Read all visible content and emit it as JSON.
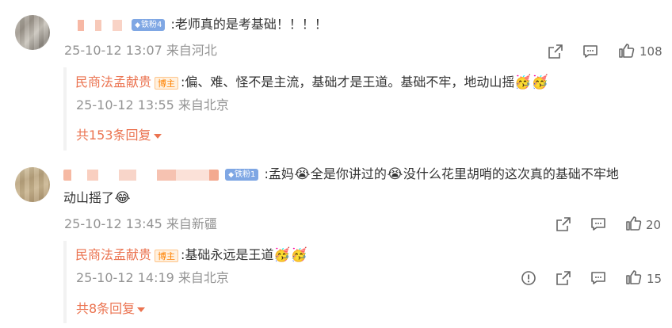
{
  "comments": [
    {
      "user_name_hidden": "",
      "fan_badge": "铁粉4",
      "text": ":老师真的是考基础！！！！",
      "meta": "25-10-12 13:07  来自河北",
      "likes": "108",
      "reply": {
        "author": "民商法孟献贵",
        "host_badge": "博主",
        "text": ":偏、难、怪不是主流，基础才是王道。基础不牢，地动山摇",
        "emoji": "🥳🥳",
        "meta": "25-10-12 13:55  来自北京"
      },
      "more_replies": "共153条回复"
    },
    {
      "user_name_hidden": "",
      "fan_badge": "铁粉1",
      "text_part1": ":孟妈",
      "text_part2": "全是你讲过的",
      "text_part3": "没什么花里胡哨的这次真的基础不牢地",
      "text_line2": "动山摇了",
      "emoji_cry": "😭",
      "emoji_laugh": "😂",
      "meta": "25-10-12 13:45  来自新疆",
      "likes": "20",
      "reply": {
        "author": "民商法孟献贵",
        "host_badge": "博主",
        "text": ":基础永远是王道",
        "emoji": "🥳🥳",
        "meta": "25-10-12 14:19  来自北京",
        "likes": "15"
      },
      "more_replies": "共8条回复"
    }
  ],
  "icons": {
    "share": "share-icon",
    "comment": "comment-icon",
    "like": "thumbs-up-icon",
    "report": "report-icon"
  },
  "colors": {
    "accent": "#eb7350",
    "meta": "#939393",
    "fan_badge": "#7fa7e4"
  }
}
